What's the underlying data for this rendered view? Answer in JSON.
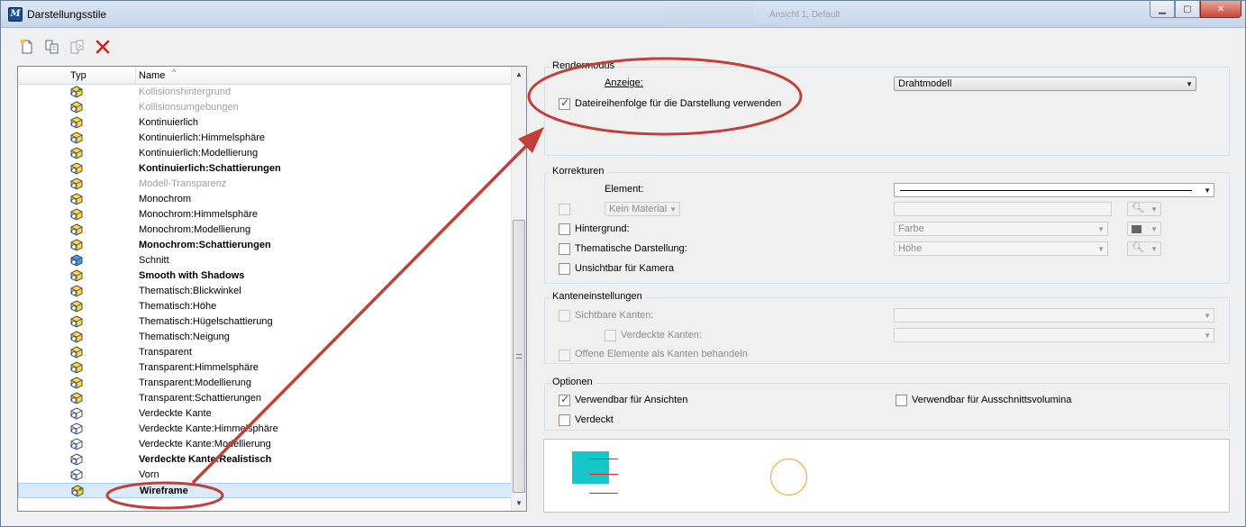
{
  "window": {
    "title": "Darstellungsstile",
    "app_icon": "microstation-icon",
    "background_tabs": [
      "Ansicht 1, Default"
    ]
  },
  "toolbar": {
    "buttons": [
      "new-style-icon",
      "copy-style-icon",
      "paste-style-icon",
      "delete-icon"
    ]
  },
  "list": {
    "columns": {
      "type": "Typ",
      "name": "Name"
    },
    "rows": [
      {
        "name": "Kollisionshintergrund",
        "state": "disabled",
        "icon": "yellow-cube-icon"
      },
      {
        "name": "Kollisionsumgebungen",
        "state": "disabled",
        "icon": "cube-icon"
      },
      {
        "name": "Kontinuierlich",
        "state": "normal",
        "icon": "cube-icon"
      },
      {
        "name": "Kontinuierlich:Himmelsphäre",
        "state": "normal",
        "icon": "cube-icon"
      },
      {
        "name": "Kontinuierlich:Modellierung",
        "state": "normal",
        "icon": "cube-icon"
      },
      {
        "name": "Kontinuierlich:Schattierungen",
        "state": "bold",
        "icon": "cube-icon"
      },
      {
        "name": "Modell-Transparenz",
        "state": "disabled",
        "icon": "cube-icon"
      },
      {
        "name": "Monochrom",
        "state": "normal",
        "icon": "cube-icon"
      },
      {
        "name": "Monochrom:Himmelsphäre",
        "state": "normal",
        "icon": "cube-icon"
      },
      {
        "name": "Monochrom:Modellierung",
        "state": "normal",
        "icon": "cube-icon"
      },
      {
        "name": "Monochrom:Schattierungen",
        "state": "bold",
        "icon": "cube-icon"
      },
      {
        "name": "Schnitt",
        "state": "normal",
        "icon": "blue-cube-icon"
      },
      {
        "name": "Smooth with Shadows",
        "state": "bold",
        "icon": "cube-icon"
      },
      {
        "name": "Thematisch:Blickwinkel",
        "state": "normal",
        "icon": "cube-icon"
      },
      {
        "name": "Thematisch:Höhe",
        "state": "normal",
        "icon": "cube-icon"
      },
      {
        "name": "Thematisch:Hügelschattierung",
        "state": "normal",
        "icon": "cube-icon"
      },
      {
        "name": "Thematisch:Neigung",
        "state": "normal",
        "icon": "cube-icon"
      },
      {
        "name": "Transparent",
        "state": "normal",
        "icon": "cube-icon"
      },
      {
        "name": "Transparent:Himmelsphäre",
        "state": "normal",
        "icon": "cube-icon"
      },
      {
        "name": "Transparent:Modellierung",
        "state": "normal",
        "icon": "cube-icon"
      },
      {
        "name": "Transparent:Schattierungen",
        "state": "normal",
        "icon": "cube-icon"
      },
      {
        "name": "Verdeckte Kante",
        "state": "normal",
        "icon": "outline-cube-icon"
      },
      {
        "name": "Verdeckte Kante:Himmelsphäre",
        "state": "normal",
        "icon": "outline-cube-icon"
      },
      {
        "name": "Verdeckte Kante:Modellierung",
        "state": "normal",
        "icon": "outline-cube-icon"
      },
      {
        "name": "Verdeckte Kante:Realistisch",
        "state": "bold",
        "icon": "outline-cube-icon"
      },
      {
        "name": "Vorn",
        "state": "normal",
        "icon": "outline-cube-icon"
      },
      {
        "name": "Wireframe",
        "state": "bold-selected",
        "icon": "yellow-cube-icon"
      }
    ]
  },
  "rendermodus": {
    "title": "Rendermodus",
    "display_label": "Anzeige:",
    "display_value": "Drahtmodell",
    "file_order_label": "Dateireihenfolge für die Darstellung verwenden",
    "file_order_checked": true
  },
  "korrekturen": {
    "title": "Korrekturen",
    "element_label": "Element:",
    "material_value": "Kein Material",
    "background_label": "Hintergrund:",
    "background_value": "Farbe",
    "thematic_label": "Thematische Darstellung:",
    "thematic_value": "Höhe",
    "invisible_label": "Unsichtbar für Kamera"
  },
  "kanten": {
    "title": "Kanteneinstellungen",
    "visible_label": "Sichtbare Kanten:",
    "hidden_label": "Verdeckte Kanten:",
    "open_label": "Offene Elemente als Kanten behandeln"
  },
  "optionen": {
    "title": "Optionen",
    "views_label": "Verwendbar für Ansichten",
    "views_checked": true,
    "clip_label": "Verwendbar für Ausschnittsvolumina",
    "clip_checked": false,
    "hidden_label": "Verdeckt",
    "hidden_checked": false
  },
  "colors": {
    "annotation": "#c0403a",
    "preview_fill": "#16c7c9",
    "preview_line": "#e02020",
    "preview_circle": "#f0a020",
    "selection": "#dbeaf8"
  }
}
